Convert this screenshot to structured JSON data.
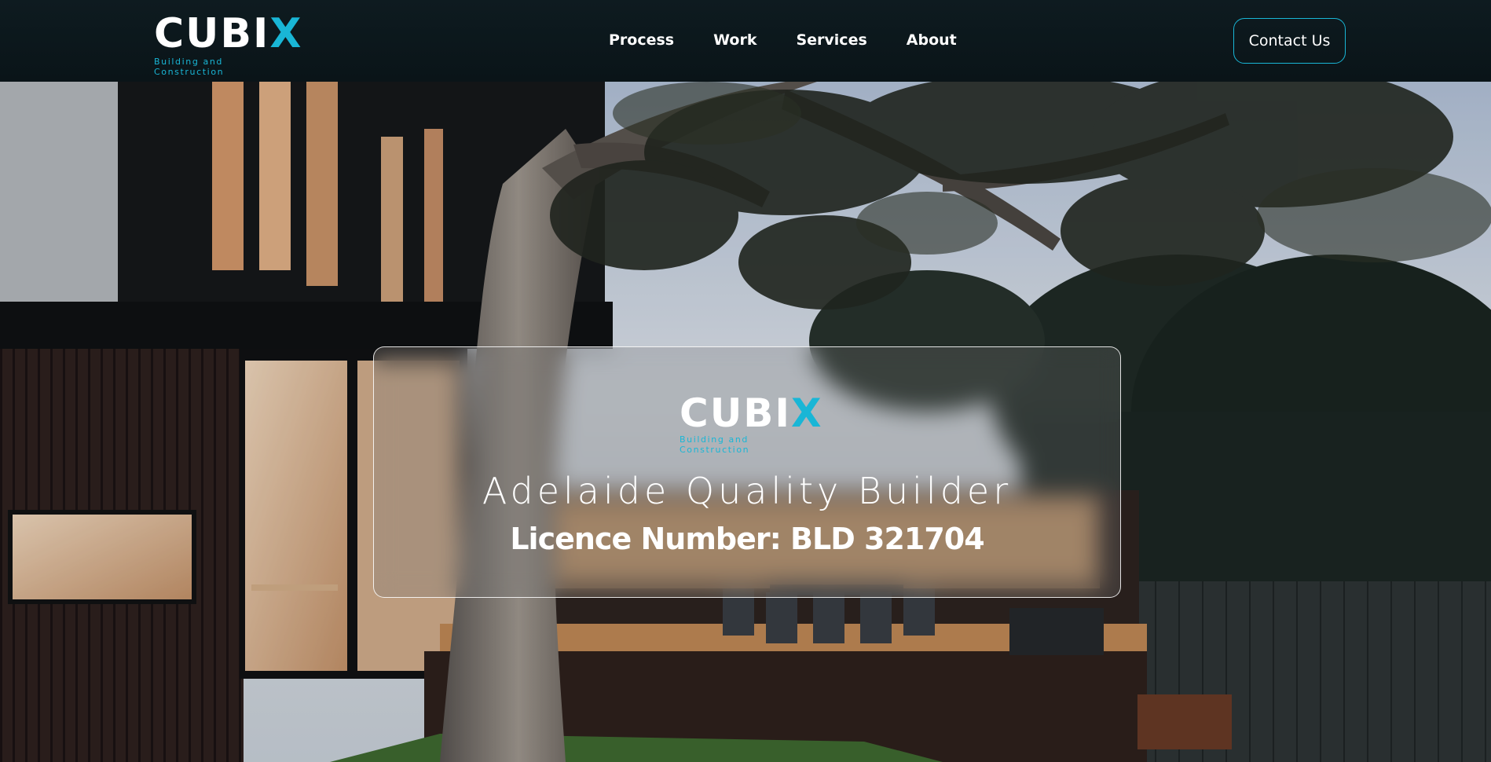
{
  "brand": {
    "name_main": "CUBI",
    "name_mark": "X",
    "tagline": "Building and Construction",
    "accent_color": "#19b6d6"
  },
  "nav": {
    "links": [
      "Process",
      "Work",
      "Services",
      "About"
    ],
    "contact_label": "Contact Us"
  },
  "hero": {
    "title": "Adelaide Quality Builder",
    "licence": "Licence Number: BLD 321704",
    "background_scene": "photo-house-deck-tree-dusk"
  }
}
